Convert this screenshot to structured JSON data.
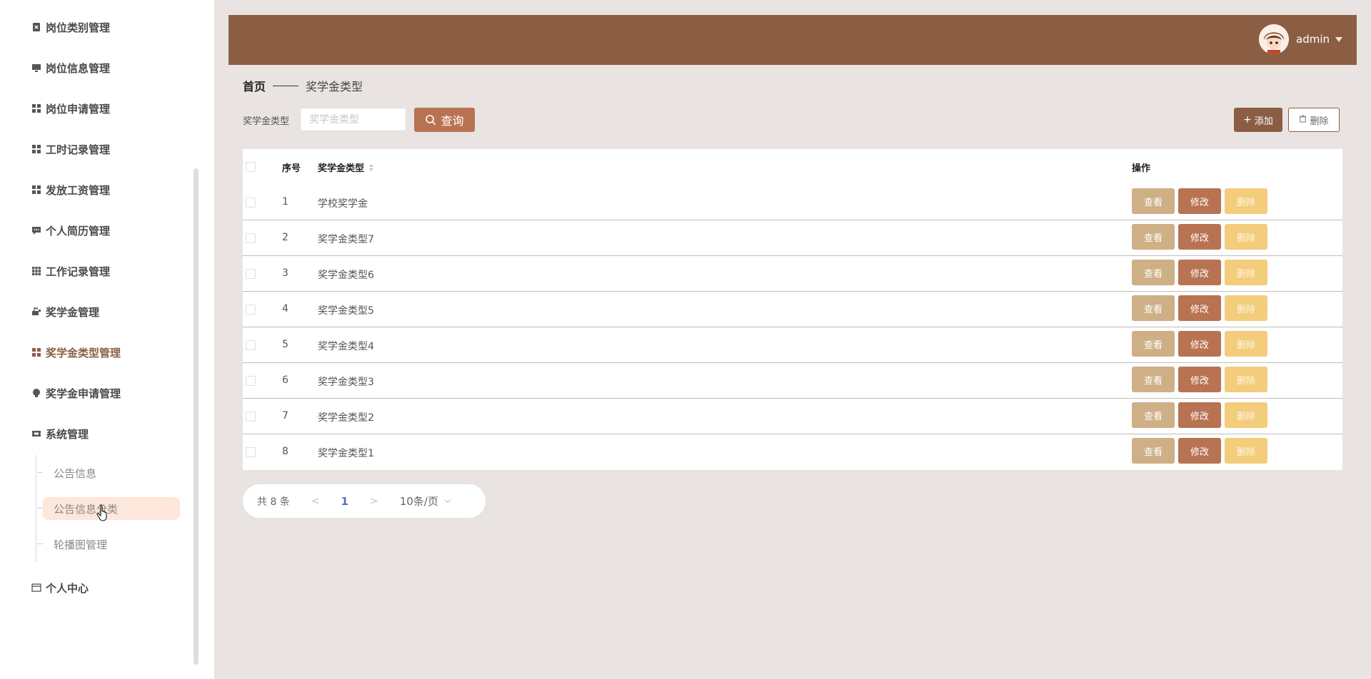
{
  "sidebar": {
    "items": [
      {
        "label": "岗位类别管理",
        "icon": "clipboard-icon"
      },
      {
        "label": "岗位信息管理",
        "icon": "monitor-icon"
      },
      {
        "label": "岗位申请管理",
        "icon": "grid-icon"
      },
      {
        "label": "工时记录管理",
        "icon": "grid-icon"
      },
      {
        "label": "发放工资管理",
        "icon": "grid-icon"
      },
      {
        "label": "个人简历管理",
        "icon": "chat-icon"
      },
      {
        "label": "工作记录管理",
        "icon": "grid-9-icon"
      },
      {
        "label": "奖学金管理",
        "icon": "mailbox-icon"
      },
      {
        "label": "奖学金类型管理",
        "icon": "grid-icon"
      },
      {
        "label": "奖学金申请管理",
        "icon": "bulb-icon"
      },
      {
        "label": "系统管理",
        "icon": "ticket-icon"
      }
    ],
    "sub_items": [
      {
        "label": "公告信息"
      },
      {
        "label": "公告信息分类"
      },
      {
        "label": "轮播图管理"
      }
    ],
    "personal": {
      "label": "个人中心",
      "icon": "window-icon"
    }
  },
  "header": {
    "username": "admin"
  },
  "breadcrumb": {
    "home": "首页",
    "current": "奖学金类型"
  },
  "search": {
    "label": "奖学金类型",
    "placeholder": "奖学金类型",
    "value": "",
    "query_label": "查询",
    "add_label": "添加",
    "delete_label": "删除"
  },
  "table": {
    "columns": {
      "index": "序号",
      "name": "奖学金类型",
      "ops": "操作"
    },
    "rows": [
      {
        "index": "1",
        "name": "学校奖学金"
      },
      {
        "index": "2",
        "name": "奖学金类型7"
      },
      {
        "index": "3",
        "name": "奖学金类型6"
      },
      {
        "index": "4",
        "name": "奖学金类型5"
      },
      {
        "index": "5",
        "name": "奖学金类型4"
      },
      {
        "index": "6",
        "name": "奖学金类型3"
      },
      {
        "index": "7",
        "name": "奖学金类型2"
      },
      {
        "index": "8",
        "name": "奖学金类型1"
      }
    ],
    "actions": {
      "view": "查看",
      "edit": "修改",
      "remove": "删除"
    }
  },
  "pagination": {
    "total": "共 8 条",
    "prev": "<",
    "page": "1",
    "next": ">",
    "page_size": "10条/页"
  },
  "colors": {
    "brand": "#8b5e44",
    "accent": "#b87352",
    "view": "#ceaf86",
    "remove": "#f3cc7c",
    "active_sub_bg": "#fde6da"
  }
}
